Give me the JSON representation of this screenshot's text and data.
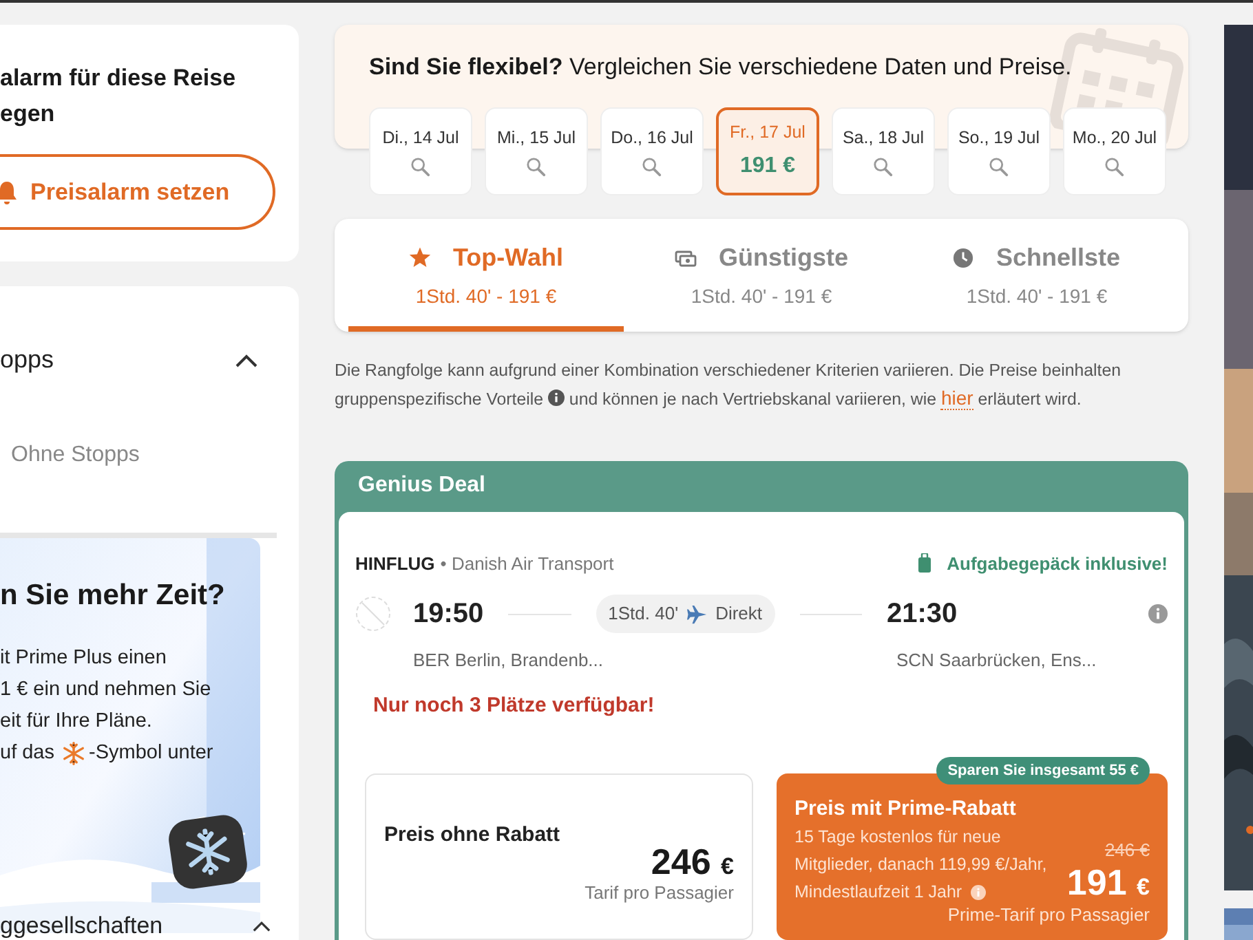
{
  "price_alert": {
    "title_lines": [
      "alarm für diese Reise",
      "egen"
    ],
    "button": "Preisalarm setzen"
  },
  "stops_filter": {
    "title": "opps",
    "expanded": true,
    "option": "Ohne Stopps"
  },
  "promo": {
    "heading": "n Sie mehr Zeit?",
    "lines": [
      "it Prime Plus einen",
      "1 € ein und nehmen Sie",
      "eit für Ihre Pläne."
    ],
    "last_line_before": "uf das",
    "last_line_after": "-Symbol unter"
  },
  "airlines_filter": {
    "title": "ggesellschaften"
  },
  "flexible": {
    "title": "**Sind Sie flexibel?** Vergleichen Sie verschiedene Daten und Preise.",
    "dates": [
      {
        "label": "Di., 14 Jul",
        "selected": false
      },
      {
        "label": "Mi., 15 Jul",
        "selected": false
      },
      {
        "label": "Do., 16 Jul",
        "selected": false
      },
      {
        "label": "Fr., 17 Jul",
        "price": "191 €",
        "selected": true
      },
      {
        "label": "Sa., 18 Jul",
        "selected": false
      },
      {
        "label": "So., 19 Jul",
        "selected": false
      },
      {
        "label": "Mo., 20 Jul",
        "selected": false
      }
    ]
  },
  "sort_tabs": [
    {
      "kind": "star",
      "label": "Top-Wahl",
      "detail": "1Std. 40' - 191 €",
      "selected": true
    },
    {
      "kind": "money",
      "label": "Günstigste",
      "detail": "1Std. 40' - 191 €",
      "selected": false
    },
    {
      "kind": "clock",
      "label": "Schnellste",
      "detail": "1Std. 40' - 191 €",
      "selected": false
    }
  ],
  "note": {
    "text": "Die Rangfolge kann aufgrund einer Kombination verschiedener Kriterien variieren. Die Preise beinhalten gruppenspezifische Vorteile",
    "text_after": "und können je nach Vertriebskanal variieren, wie",
    "link": "hier",
    "text_end": "erläutert wird."
  },
  "deal": {
    "header": "Genius Deal",
    "direction": "HINFLUG",
    "airline": "• Danish Air Transport",
    "baggage": "Aufgabegepäck inklusive!",
    "departure_time": "19:50",
    "duration": "1Std. 40'",
    "stops": "Direkt",
    "arrival_time": "21:30",
    "departure_airport": "BER Berlin, Brandenb...",
    "arrival_airport": "SCN Saarbrücken, Ens...",
    "availability": "Nur noch 3 Plätze verfügbar!",
    "regular": {
      "title": "Preis ohne Rabatt",
      "amount": "246",
      "currency": "€",
      "caption": "Tarif pro Passagier"
    },
    "prime": {
      "badge": "Sparen Sie insgesamt 55 €",
      "title": "Preis mit Prime-Rabatt",
      "terms": [
        "15 Tage kostenlos für neue",
        "Mitglieder, danach 119,99 €/Jahr,",
        "Mindestlaufzeit 1 Jahr"
      ],
      "old_price": "246 €",
      "amount": "191",
      "currency": "€",
      "caption": "Prime-Tarif pro Passagier"
    }
  }
}
